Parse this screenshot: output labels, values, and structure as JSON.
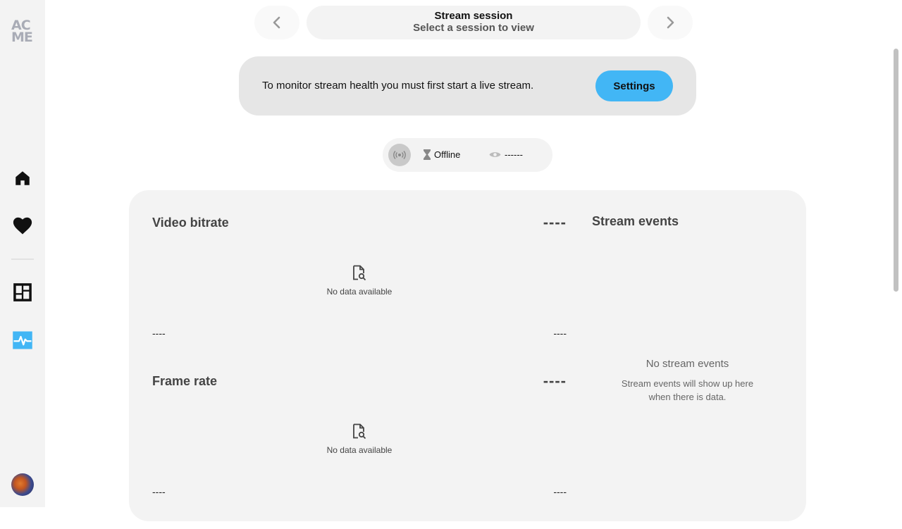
{
  "sidebar": {
    "logo": "AC ME",
    "items": [
      {
        "name": "home"
      },
      {
        "name": "favorites"
      },
      {
        "name": "dashboard"
      },
      {
        "name": "stream-health",
        "active": true
      }
    ],
    "accent_color": "#42b6f5"
  },
  "session": {
    "title": "Stream session",
    "subtitle": "Select a session to view"
  },
  "banner": {
    "message": "To monitor stream health you must first start a live stream.",
    "button_label": "Settings",
    "button_color": "#42b6f5"
  },
  "status": {
    "state": "Offline",
    "viewers": "------"
  },
  "metrics": [
    {
      "title": "Video bitrate",
      "value": "----",
      "empty_text": "No data available",
      "axis_left": "----",
      "axis_right": "----"
    },
    {
      "title": "Frame rate",
      "value": "----",
      "empty_text": "No data available",
      "axis_left": "----",
      "axis_right": "----"
    }
  ],
  "events": {
    "title": "Stream events",
    "empty_title": "No stream events",
    "empty_text": "Stream events will show up here when there is data."
  }
}
